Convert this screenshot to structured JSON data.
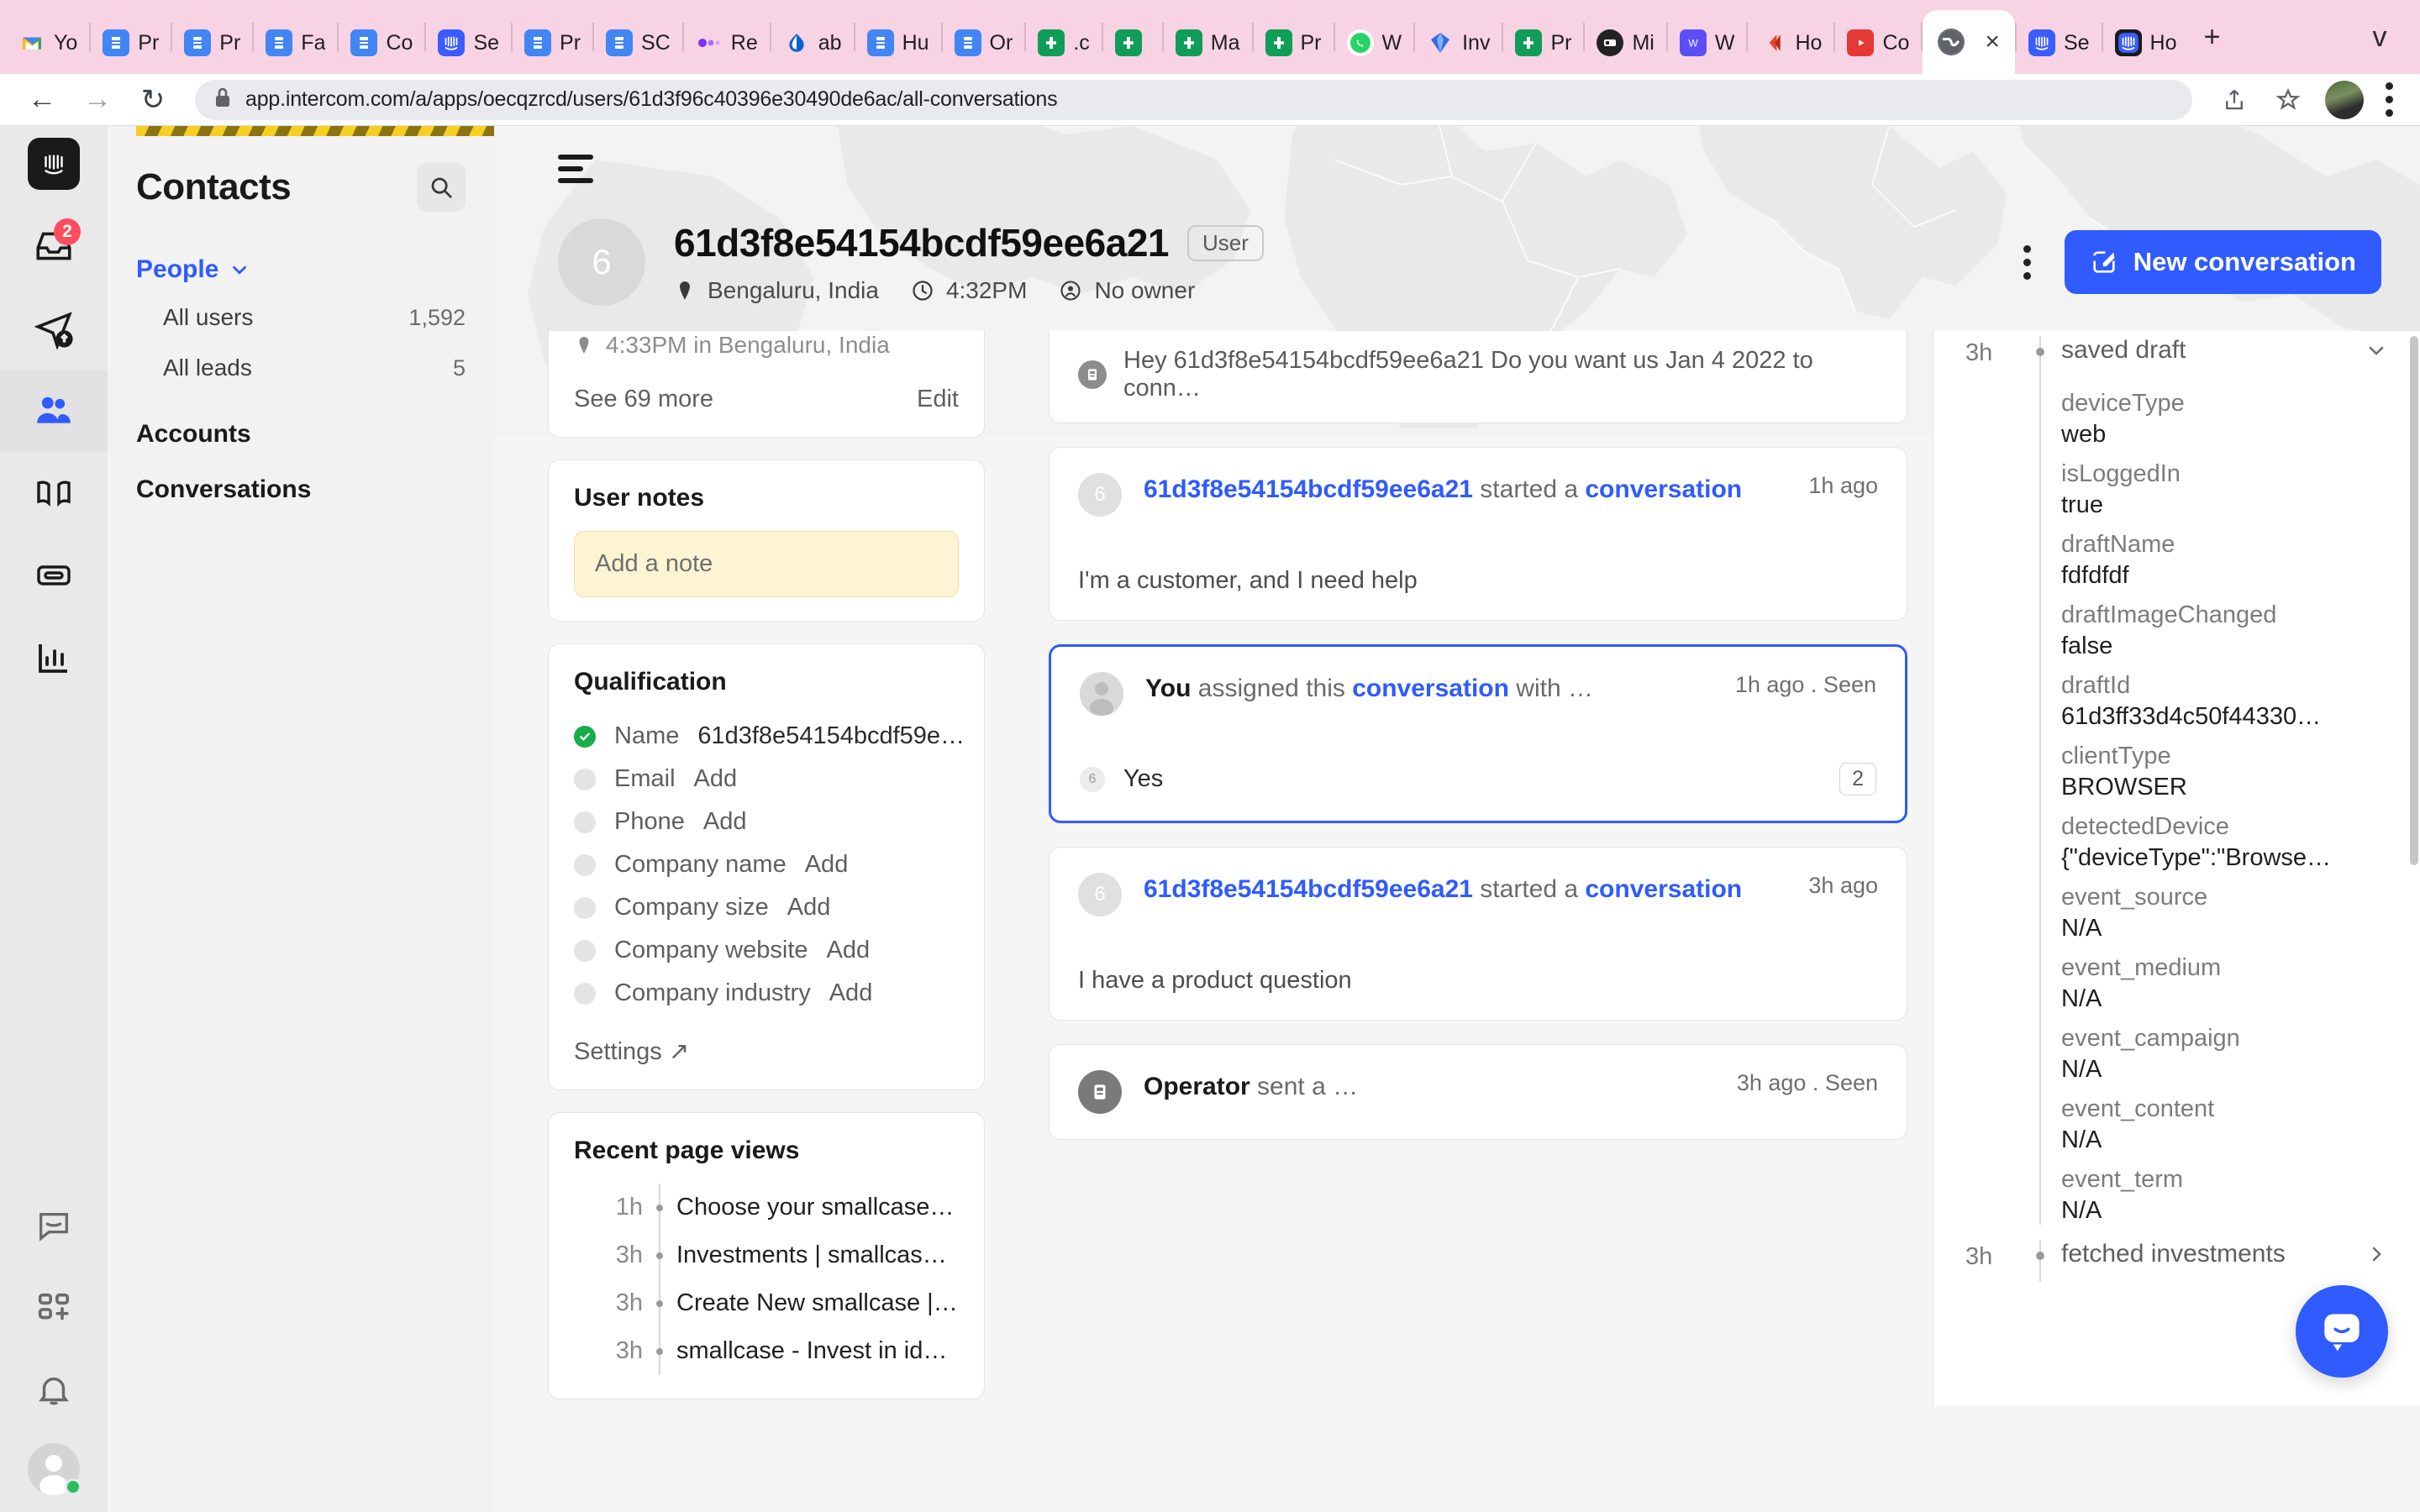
{
  "browser": {
    "tabs": [
      {
        "label": "Yo",
        "icon": "gmail-icon",
        "style": "fav-gmail"
      },
      {
        "label": "Pr",
        "icon": "docs-icon",
        "style": "fav-blue"
      },
      {
        "label": "Pr",
        "icon": "docs-icon",
        "style": "fav-blue"
      },
      {
        "label": "Fa",
        "icon": "docs-icon",
        "style": "fav-blue"
      },
      {
        "label": "Co",
        "icon": "docs-icon",
        "style": "fav-blue"
      },
      {
        "label": "Se",
        "icon": "intercom-icon",
        "style": "fav-intercom-blue"
      },
      {
        "label": "Pr",
        "icon": "docs-icon",
        "style": "fav-blue"
      },
      {
        "label": "SC",
        "icon": "docs-icon",
        "style": "fav-blue"
      },
      {
        "label": "Re",
        "icon": "dots-icon",
        "style": "fav-plain"
      },
      {
        "label": "ab",
        "icon": "drop-icon",
        "style": "fav-plain"
      },
      {
        "label": "Hu",
        "icon": "docs-icon",
        "style": "fav-blue"
      },
      {
        "label": "Or",
        "icon": "docs-icon",
        "style": "fav-blue"
      },
      {
        "label": ".c",
        "icon": "sheets-icon",
        "style": "fav-green"
      },
      {
        "label": "",
        "icon": "sheets-icon",
        "style": "fav-green"
      },
      {
        "label": "Ma",
        "icon": "sheets-icon",
        "style": "fav-green"
      },
      {
        "label": "Pr",
        "icon": "sheets-icon",
        "style": "fav-green"
      },
      {
        "label": "W",
        "icon": "whatsapp-icon",
        "style": "fav-white"
      },
      {
        "label": "Inv",
        "icon": "diamond-icon",
        "style": "fav-plain"
      },
      {
        "label": "Pr",
        "icon": "sheets-icon",
        "style": "fav-green"
      },
      {
        "label": "Mi",
        "icon": "camera-icon",
        "style": "fav-dark"
      },
      {
        "label": "W",
        "icon": "word-icon",
        "style": "fav-purple"
      },
      {
        "label": "Ho",
        "icon": "chevron-left-icon",
        "style": "fav-plain"
      },
      {
        "label": "Co",
        "icon": "youtube-icon",
        "style": "fav-red"
      },
      {
        "label": "",
        "icon": "globe-icon",
        "style": "fav-gray",
        "active": true
      },
      {
        "label": "Se",
        "icon": "intercom-icon",
        "style": "fav-intercom-blue"
      },
      {
        "label": "Ho",
        "icon": "intercom-icon",
        "style": "fav-intercom"
      }
    ],
    "new_tab_label": "+",
    "tab_list_chevron": "v",
    "close_tab_label": "×",
    "nav": {
      "back": "←",
      "forward": "→",
      "reload": "↻"
    },
    "url": "app.intercom.com/a/apps/oecqzrcd/users/61d3f96c40396e30490de6ac/all-conversations",
    "lock_icon": "lock-icon",
    "share_icon": "share-icon",
    "bookmark_icon": "star-icon",
    "menu_icon": "three-dot-menu-icon"
  },
  "rail": {
    "logo": "intercom-logo",
    "items": [
      {
        "name": "inbox-icon",
        "badge": "2"
      },
      {
        "name": "outbound-icon",
        "badge": ""
      },
      {
        "name": "contacts-icon",
        "badge": "",
        "active": true
      },
      {
        "name": "articles-icon",
        "badge": ""
      },
      {
        "name": "messenger-icon",
        "badge": ""
      },
      {
        "name": "reports-icon",
        "badge": ""
      },
      {
        "name": "help-icon",
        "badge": ""
      },
      {
        "name": "apps-icon",
        "badge": ""
      },
      {
        "name": "notifications-icon",
        "badge": ""
      }
    ]
  },
  "contacts": {
    "title": "Contacts",
    "search_icon": "search-icon",
    "group_people": "People",
    "group_chevron": "chevron-down-icon",
    "rows": [
      {
        "label": "All users",
        "count": "1,592"
      },
      {
        "label": "All leads",
        "count": "5"
      }
    ],
    "group_accounts": "Accounts",
    "group_conversations": "Conversations"
  },
  "user": {
    "hamburger": "hamburger-icon",
    "avatar_initial": "6",
    "name": "61d3f8e54154bcdf59ee6a21",
    "type_chip": "User",
    "location_icon": "pin-icon",
    "location": "Bengaluru, India",
    "clock_icon": "clock-icon",
    "local_time": "4:32PM",
    "owner_icon": "owner-icon",
    "owner": "No owner",
    "kebab": "more-options-icon",
    "new_conversation": "New conversation",
    "compose_icon": "compose-icon"
  },
  "left_panel": {
    "clipped_card": {
      "pin_icon": "pin-icon",
      "line": "4:33PM in Bengaluru, India",
      "see_more": "See 69 more",
      "edit": "Edit"
    },
    "notes": {
      "title": "User notes",
      "placeholder": "Add a note"
    },
    "qualification": {
      "title": "Qualification",
      "rows": [
        {
          "label": "Name",
          "value": "61d3f8e54154bcdf59e…",
          "done": true
        },
        {
          "label": "Email",
          "value": "Add",
          "done": false
        },
        {
          "label": "Phone",
          "value": "Add",
          "done": false
        },
        {
          "label": "Company name",
          "value": "Add",
          "done": false
        },
        {
          "label": "Company size",
          "value": "Add",
          "done": false
        },
        {
          "label": "Company website",
          "value": "Add",
          "done": false
        },
        {
          "label": "Company industry",
          "value": "Add",
          "done": false
        }
      ],
      "settings": "Settings ↗"
    },
    "page_views": {
      "title": "Recent page views",
      "rows": [
        {
          "time": "1h",
          "title": "Choose your smallcase | …"
        },
        {
          "time": "3h",
          "title": "Investments | smallcase -…"
        },
        {
          "time": "3h",
          "title": "Create New smallcase | s…"
        },
        {
          "time": "3h",
          "title": "smallcase - Invest in ideas"
        }
      ]
    }
  },
  "feed": {
    "clipped_top": {
      "icon": "operator-icon",
      "text": "Hey 61d3f8e54154bcdf59ee6a21 Do you want us Jan 4 2022 to conn…"
    },
    "cards": [
      {
        "avatar": "6",
        "avatar_kind": "user",
        "actor": "61d3f8e54154bcdf59ee6a21",
        "verb": " started a ",
        "link": "conversation",
        "time": "1h ago",
        "body": "I'm a customer, and I need help",
        "selected": false
      },
      {
        "avatar": "",
        "avatar_kind": "you",
        "actor": "You",
        "verb": " assigned this ",
        "link": "conversation",
        "suffix": " with …",
        "time": "1h ago . Seen",
        "reply_avatar": "6",
        "reply_text": "Yes",
        "reply_count": "2",
        "selected": true
      },
      {
        "avatar": "6",
        "avatar_kind": "user",
        "actor": "61d3f8e54154bcdf59ee6a21",
        "verb": " started a ",
        "link": "conversation",
        "time": "3h ago",
        "body": "I have a product question",
        "selected": false
      },
      {
        "avatar": "",
        "avatar_kind": "operator",
        "actor": "Operator",
        "verb": " sent a …",
        "link": "",
        "time": "3h ago . Seen",
        "selected": false
      }
    ]
  },
  "attributes": {
    "group_time": "3h",
    "group_title": "saved draft",
    "collapse_icon": "chevron-down-icon",
    "rows": [
      {
        "key": "deviceType",
        "value": "web"
      },
      {
        "key": "isLoggedIn",
        "value": "true"
      },
      {
        "key": "draftName",
        "value": "fdfdfdf"
      },
      {
        "key": "draftImageChanged",
        "value": "false"
      },
      {
        "key": "draftId",
        "value": "61d3ff33d4c50f44330…"
      },
      {
        "key": "clientType",
        "value": "BROWSER"
      },
      {
        "key": "detectedDevice",
        "value": "{\"deviceType\":\"Browse…"
      },
      {
        "key": "event_source",
        "value": "N/A"
      },
      {
        "key": "event_medium",
        "value": "N/A"
      },
      {
        "key": "event_campaign",
        "value": "N/A"
      },
      {
        "key": "event_content",
        "value": "N/A"
      },
      {
        "key": "event_term",
        "value": "N/A"
      }
    ],
    "next_group_time": "3h",
    "next_group_title": "fetched investments",
    "next_group_icon": "chevron-right-icon",
    "messenger_fab": "intercom-messenger-icon"
  },
  "colors": {
    "accent": "#2f5bff",
    "badge": "#ff4d5e",
    "success": "#17ad4a",
    "note_bg": "#fdf4d3",
    "tabbar": "#f7d3e3"
  }
}
